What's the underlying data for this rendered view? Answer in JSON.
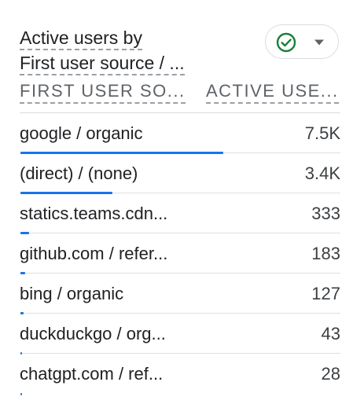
{
  "card": {
    "title_line1": "Active users by",
    "title_line2": "First user source / ..."
  },
  "status": {
    "icon": "check-circle-icon",
    "status_color": "#188038",
    "dropdown_icon": "chevron-down-icon"
  },
  "table": {
    "col_source": "FIRST USER SO...",
    "col_users": "ACTIVE USE...",
    "bar_color": "#1a73e8",
    "max_value": 7500,
    "rows": [
      {
        "label": "google / organic",
        "value": "7.5K",
        "number": 7500
      },
      {
        "label": "(direct) / (none)",
        "value": "3.4K",
        "number": 3400
      },
      {
        "label": "statics.teams.cdn...",
        "value": "333",
        "number": 333
      },
      {
        "label": "github.com / refer...",
        "value": "183",
        "number": 183
      },
      {
        "label": "bing / organic",
        "value": "127",
        "number": 127
      },
      {
        "label": "duckduckgo / org...",
        "value": "43",
        "number": 43
      },
      {
        "label": "chatgpt.com / ref...",
        "value": "28",
        "number": 28
      }
    ]
  }
}
